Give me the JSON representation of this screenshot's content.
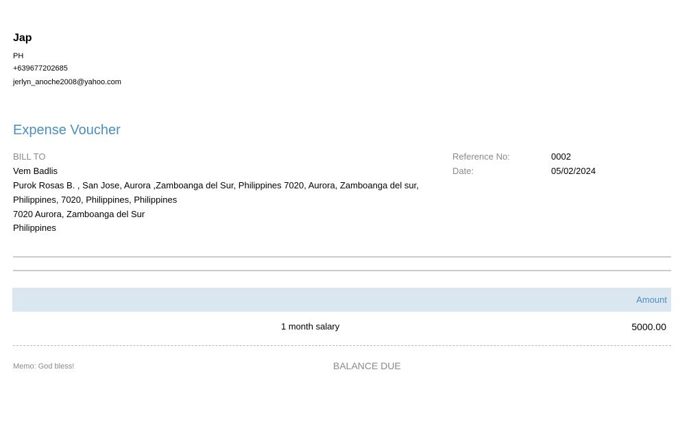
{
  "company": {
    "name": "Jap",
    "country": "PH",
    "phone": "+639677202685",
    "email": "jerlyn_anoche2008@yahoo.com"
  },
  "document_title": "Expense Voucher",
  "bill_to": {
    "label": "BILL TO",
    "name": "Vem Badlis",
    "address_lines": [
      "Purok Rosas B. , San Jose, Aurora ,Zamboanga del Sur, Philippines  7020, Aurora, Zamboanga del sur,",
      "Philippines, 7020, Philippines, Philippines",
      "7020 Aurora, Zamboanga del Sur",
      "Philippines"
    ]
  },
  "meta": {
    "reference_label": "Reference No:",
    "reference_value": "0002",
    "date_label": "Date:",
    "date_value": "05/02/2024"
  },
  "table": {
    "header_amount": "Amount",
    "rows": [
      {
        "description": "1 month salary",
        "amount": "5000.00"
      }
    ]
  },
  "footer": {
    "memo": "Memo: God bless!",
    "balance_due_label": "BALANCE DUE"
  }
}
